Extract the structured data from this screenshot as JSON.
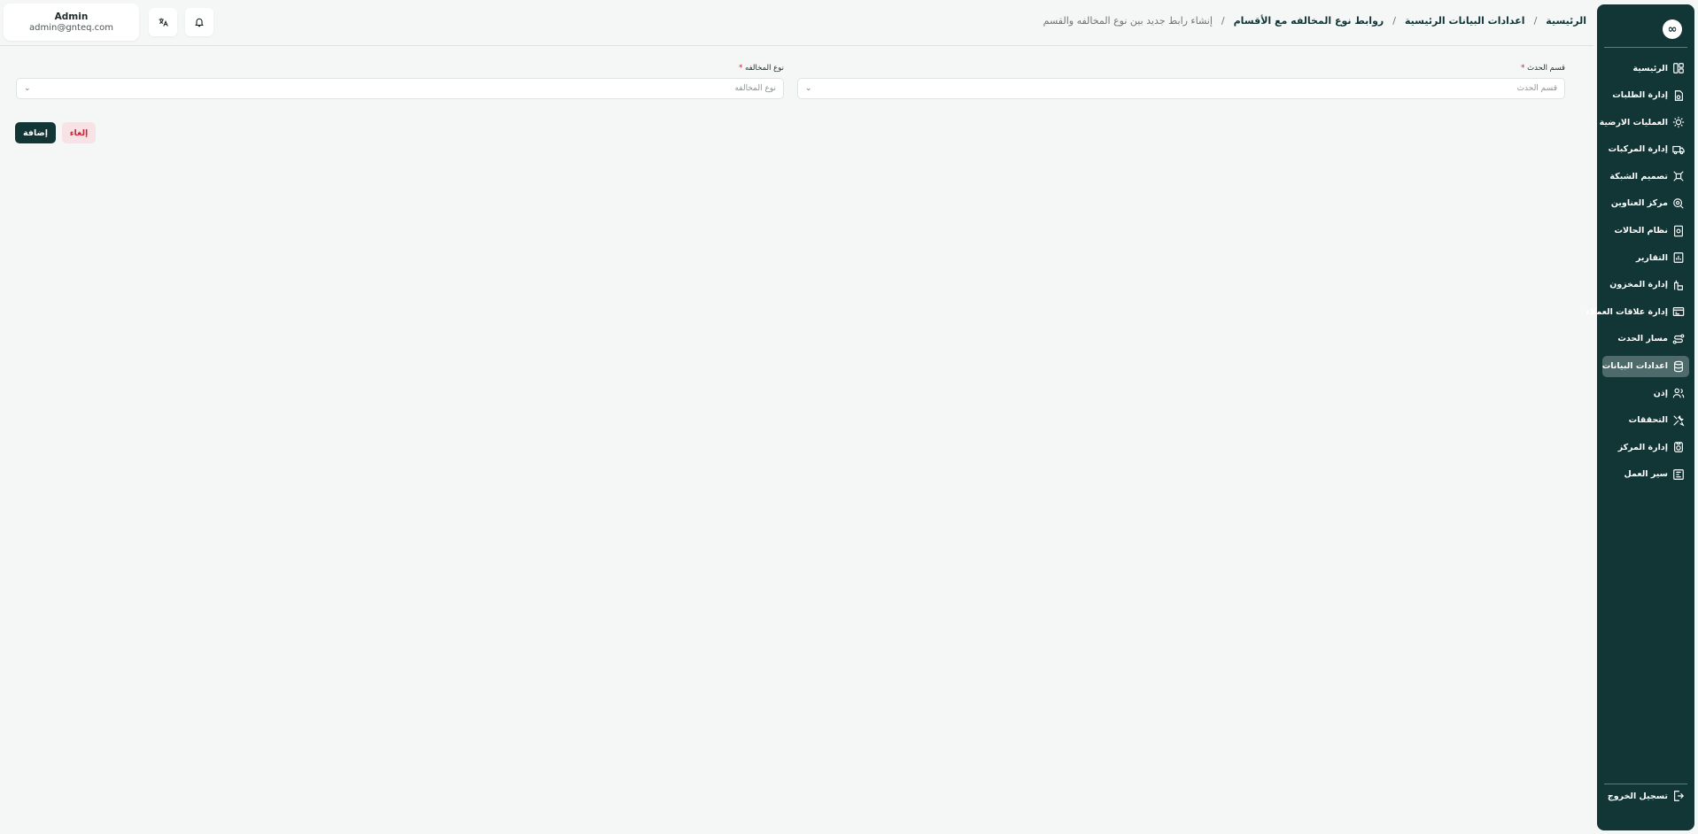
{
  "header": {
    "breadcrumb": [
      {
        "label": "الرئيسية"
      },
      {
        "label": "اعدادات البيانات الرئيسية"
      },
      {
        "label": "روابط نوع المخالفه مع الأقسام"
      },
      {
        "label": "إنشاء رابط جديد بين نوع المخالفه والقسم"
      }
    ],
    "separator": "/",
    "user": {
      "name": "Admin",
      "email": "admin@gnteq.com"
    },
    "icons": {
      "notifications": "bell-icon",
      "language": "translate-icon"
    }
  },
  "sidebar": {
    "logo_glyph": "∞",
    "items": [
      {
        "label": "الرئيسية",
        "icon": "dashboard-icon"
      },
      {
        "label": "إدارة الطلبات",
        "icon": "orders-icon"
      },
      {
        "label": "العمليات الارضية",
        "icon": "ground-operations-icon"
      },
      {
        "label": "إدارة المركبات",
        "icon": "truck-icon"
      },
      {
        "label": "تصميم الشبكة",
        "icon": "network-icon"
      },
      {
        "label": "مركز العناوين",
        "icon": "location-icon"
      },
      {
        "label": "نظام الحالات",
        "icon": "status-icon"
      },
      {
        "label": "التقارير",
        "icon": "reports-icon"
      },
      {
        "label": "إدارة المخزون",
        "icon": "inventory-icon"
      },
      {
        "label": "إدارة علاقات العملاء",
        "icon": "crm-icon"
      },
      {
        "label": "مسار الحدث",
        "icon": "route-icon"
      },
      {
        "label": "اعدادات البيانات",
        "icon": "database-icon"
      },
      {
        "label": "إذن",
        "icon": "users-icon"
      },
      {
        "label": "التحققات",
        "icon": "tools-icon"
      },
      {
        "label": "إدارة المركز",
        "icon": "center-icon"
      },
      {
        "label": "سير العمل",
        "icon": "workflow-icon"
      }
    ],
    "active_index": 11,
    "logout_label": "تسجيل الخروج"
  },
  "form": {
    "event_section": {
      "label": "قسم الحدث",
      "required_mark": "*",
      "placeholder": "قسم الحدث"
    },
    "violation_type": {
      "label": "نوع المخالفه",
      "required_mark": "*",
      "placeholder": "نوع المخالفه"
    }
  },
  "actions": {
    "cancel_label": "إلغاء",
    "add_label": "إضافة"
  },
  "colors": {
    "primary": "#123535",
    "active_nav": "#4e6a6a",
    "cancel_bg": "#f7e3e5",
    "cancel_text": "#c7283b",
    "background": "#f5f7f6"
  }
}
